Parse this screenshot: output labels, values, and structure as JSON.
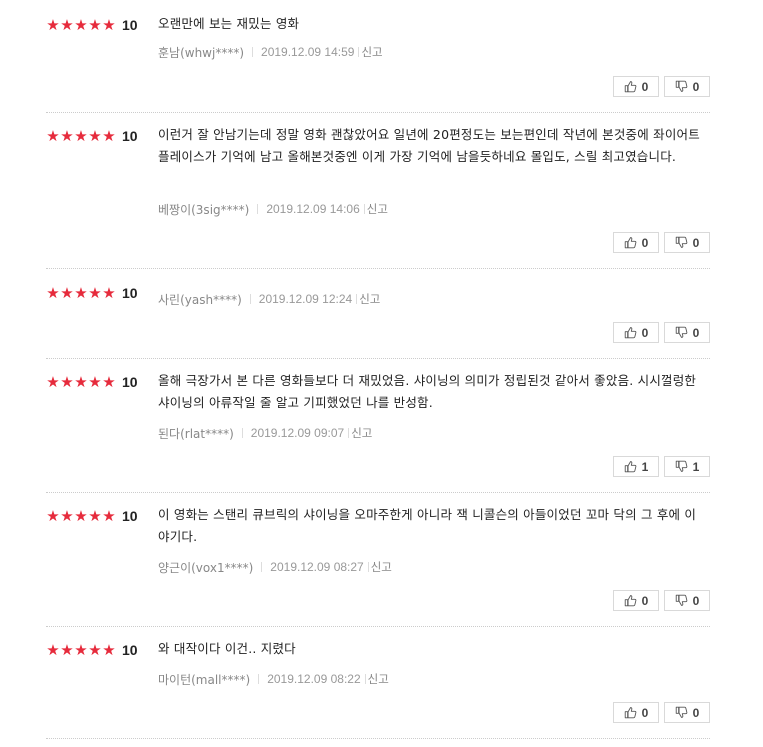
{
  "reviews": [
    {
      "score": "10",
      "text": "오랜만에 보는 재밌는 영화",
      "author": "훈남(whwj****)",
      "date": "2019.12.09 14:59",
      "report": "신고",
      "likes": "0",
      "dislikes": "0"
    },
    {
      "score": "10",
      "text": "이런거 잘 안남기는데 정말 영화 괜찮았어요 일년에 20편정도는 보는편인데 작년에 본것중에 좌이어트 플레이스가 기억에 남고 올해본것중엔 이게 가장 기억에 남을듯하네요 몰입도, 스릴 최고였습니다.",
      "author": "베짱이(3sig****)",
      "date": "2019.12.09 14:06",
      "report": "신고",
      "likes": "0",
      "dislikes": "0"
    },
    {
      "score": "10",
      "text": "",
      "author": "사린(yash****)",
      "date": "2019.12.09 12:24",
      "report": "신고",
      "likes": "0",
      "dislikes": "0"
    },
    {
      "score": "10",
      "text": "올해 극장가서 본 다른 영화들보다 더 재밌었음. 샤이닝의 의미가 정립된것 같아서 좋았음. 시시껄렁한 샤이닝의 아류작일 줄 알고 기피했었던 나를 반성함.",
      "author": "된다(rlat****)",
      "date": "2019.12.09 09:07",
      "report": "신고",
      "likes": "1",
      "dislikes": "1"
    },
    {
      "score": "10",
      "text": "이 영화는 스탠리 큐브릭의 샤이닝을 오마주한게 아니라 잭 니콜슨의 아들이었던 꼬마 닥의 그 후에 이야기다.",
      "author": "양근이(vox1****)",
      "date": "2019.12.09 08:27",
      "report": "신고",
      "likes": "0",
      "dislikes": "0"
    },
    {
      "score": "10",
      "text": "와 대작이다 이건.. 지렸다",
      "author": "마이턴(mall****)",
      "date": "2019.12.09 08:22",
      "report": "신고",
      "likes": "0",
      "dislikes": "0"
    }
  ],
  "colors": {
    "star": "#e62b3c",
    "text": "#222222",
    "meta": "#888888",
    "border": "#d9d9d9"
  },
  "icons": {
    "like": "thumbs-up-icon",
    "dislike": "thumbs-down-icon",
    "star": "star-icon"
  }
}
